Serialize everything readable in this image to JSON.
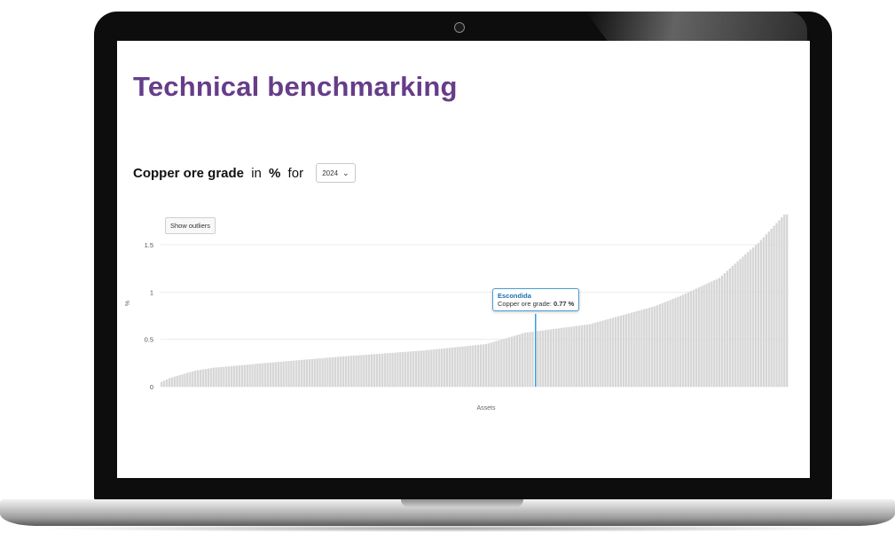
{
  "page": {
    "title": "Technical benchmarking"
  },
  "heading": {
    "metric": "Copper ore grade",
    "in_text": " in ",
    "unit": "%",
    "for_text": " for "
  },
  "year_select": {
    "value": "2024"
  },
  "buttons": {
    "show_outliers": "Show outliers"
  },
  "tooltip": {
    "asset": "Escondida",
    "label": "Copper ore grade: ",
    "value": "0.77 %"
  },
  "chart_data": {
    "type": "bar",
    "ylabel": "%",
    "xlabel": "Assets",
    "ylim": [
      0,
      1.8
    ],
    "yticks": [
      "0",
      "0.5",
      "1",
      "1.5"
    ],
    "grid": true,
    "bar_count": 242,
    "highlight": {
      "name": "Escondida",
      "value": 0.77,
      "rank": 144,
      "color": "#3a9bd9"
    },
    "bar_color": "#d6d6d6",
    "profile": [
      [
        0,
        0.05
      ],
      [
        3,
        0.09
      ],
      [
        8,
        0.13
      ],
      [
        13,
        0.17
      ],
      [
        20,
        0.2
      ],
      [
        40,
        0.25
      ],
      [
        70,
        0.32
      ],
      [
        100,
        0.38
      ],
      [
        125,
        0.45
      ],
      [
        140,
        0.57
      ],
      [
        165,
        0.66
      ],
      [
        190,
        0.85
      ],
      [
        200,
        0.96
      ],
      [
        215,
        1.15
      ],
      [
        225,
        1.4
      ],
      [
        230,
        1.52
      ],
      [
        240,
        1.82
      ],
      [
        241,
        1.82
      ]
    ]
  }
}
